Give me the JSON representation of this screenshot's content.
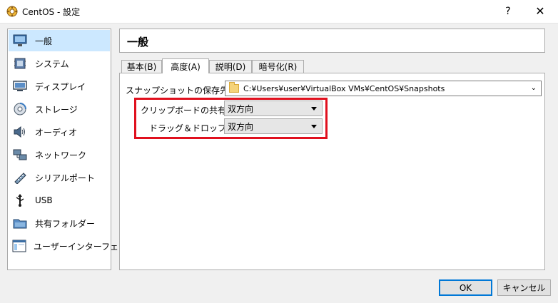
{
  "window": {
    "title": "CentOS - 設定",
    "help": "?",
    "close": "✕"
  },
  "sidebar": {
    "items": [
      {
        "label": "一般",
        "icon": "monitor-icon",
        "selected": true
      },
      {
        "label": "システム",
        "icon": "chip-icon"
      },
      {
        "label": "ディスプレイ",
        "icon": "display-icon"
      },
      {
        "label": "ストレージ",
        "icon": "disk-icon"
      },
      {
        "label": "オーディオ",
        "icon": "speaker-icon"
      },
      {
        "label": "ネットワーク",
        "icon": "network-icon"
      },
      {
        "label": "シリアルポート",
        "icon": "serial-port-icon"
      },
      {
        "label": "USB",
        "icon": "usb-icon"
      },
      {
        "label": "共有フォルダー",
        "icon": "shared-folder-icon"
      },
      {
        "label": "ユーザーインターフェース",
        "icon": "ui-icon"
      }
    ]
  },
  "header": {
    "title": "一般"
  },
  "tabs": [
    {
      "label": "基本(B)"
    },
    {
      "label": "高度(A)",
      "active": true
    },
    {
      "label": "説明(D)"
    },
    {
      "label": "暗号化(R)"
    }
  ],
  "advanced": {
    "snapshot_label": "スナップショットの保存先(N):",
    "snapshot_path": "C:¥Users¥user¥VirtualBox VMs¥CentOS¥Snapshots",
    "clipboard_label": "クリップボードの共有(S):",
    "clipboard_value": "双方向",
    "dragdrop_label": "ドラッグ＆ドロップ(D):",
    "dragdrop_value": "双方向"
  },
  "buttons": {
    "ok": "OK",
    "cancel": "キャンセル"
  },
  "colors": {
    "highlight": "#e0101e",
    "selection": "#cce8ff",
    "accent": "#0078d7"
  }
}
